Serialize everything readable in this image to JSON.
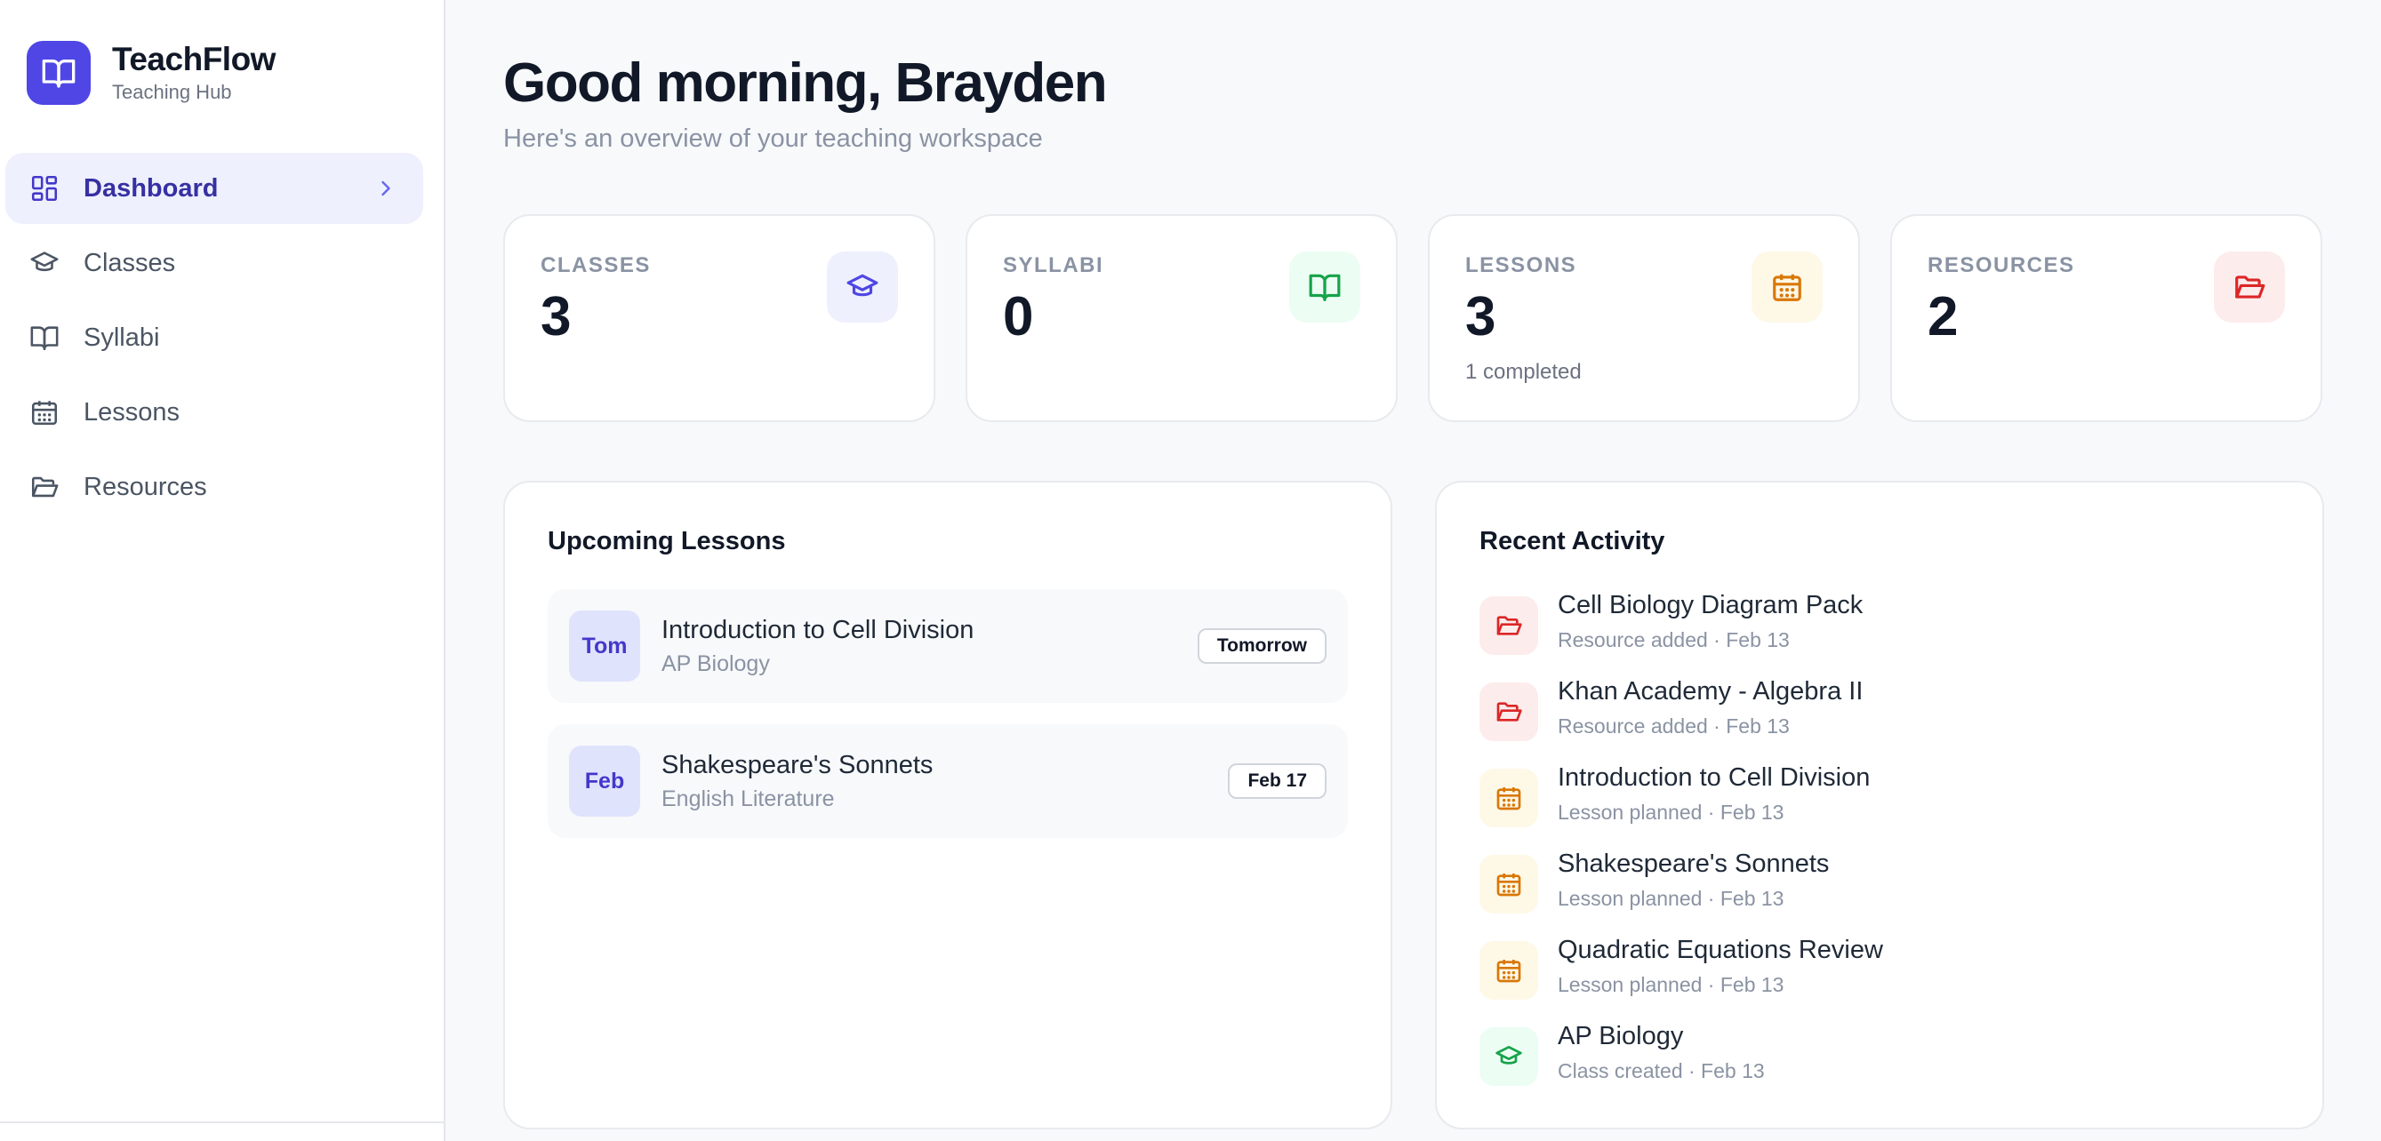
{
  "brand": {
    "name": "TeachFlow",
    "subtitle": "Teaching Hub"
  },
  "nav": [
    {
      "label": "Dashboard",
      "icon": "dashboard-icon",
      "active": true
    },
    {
      "label": "Classes",
      "icon": "graduation-cap-icon"
    },
    {
      "label": "Syllabi",
      "icon": "book-icon"
    },
    {
      "label": "Lessons",
      "icon": "calendar-icon"
    },
    {
      "label": "Resources",
      "icon": "folder-icon"
    }
  ],
  "header": {
    "greeting": "Good morning, Brayden",
    "subtitle": "Here's an overview of your teaching workspace"
  },
  "stats": [
    {
      "label": "CLASSES",
      "value": "3",
      "note": "",
      "icon": "graduation-cap-icon",
      "color": "#4f46e5"
    },
    {
      "label": "SYLLABI",
      "value": "0",
      "note": "",
      "icon": "book-icon",
      "color": "#16a34a"
    },
    {
      "label": "LESSONS",
      "value": "3",
      "note": "1 completed",
      "icon": "calendar-icon",
      "color": "#d97706"
    },
    {
      "label": "RESOURCES",
      "value": "2",
      "note": "",
      "icon": "folder-icon",
      "color": "#dc2626"
    }
  ],
  "upcoming": {
    "title": "Upcoming Lessons",
    "items": [
      {
        "badge": "Tom",
        "title": "Introduction to Cell Division",
        "subtitle": "AP Biology",
        "tag": "Tomorrow"
      },
      {
        "badge": "Feb",
        "title": "Shakespeare's Sonnets",
        "subtitle": "English Literature",
        "tag": "Feb 17"
      }
    ]
  },
  "activity": {
    "title": "Recent Activity",
    "items": [
      {
        "title": "Cell Biology Diagram Pack",
        "subtitle": "Resource added · Feb 13",
        "icon": "folder-icon"
      },
      {
        "title": "Khan Academy - Algebra II",
        "subtitle": "Resource added · Feb 13",
        "icon": "folder-icon"
      },
      {
        "title": "Introduction to Cell Division",
        "subtitle": "Lesson planned · Feb 13",
        "icon": "calendar-icon"
      },
      {
        "title": "Shakespeare's Sonnets",
        "subtitle": "Lesson planned · Feb 13",
        "icon": "calendar-icon"
      },
      {
        "title": "Quadratic Equations Review",
        "subtitle": "Lesson planned · Feb 13",
        "icon": "calendar-icon"
      },
      {
        "title": "AP Biology",
        "subtitle": "Class created · Feb 13",
        "icon": "graduation-cap-icon"
      }
    ]
  }
}
